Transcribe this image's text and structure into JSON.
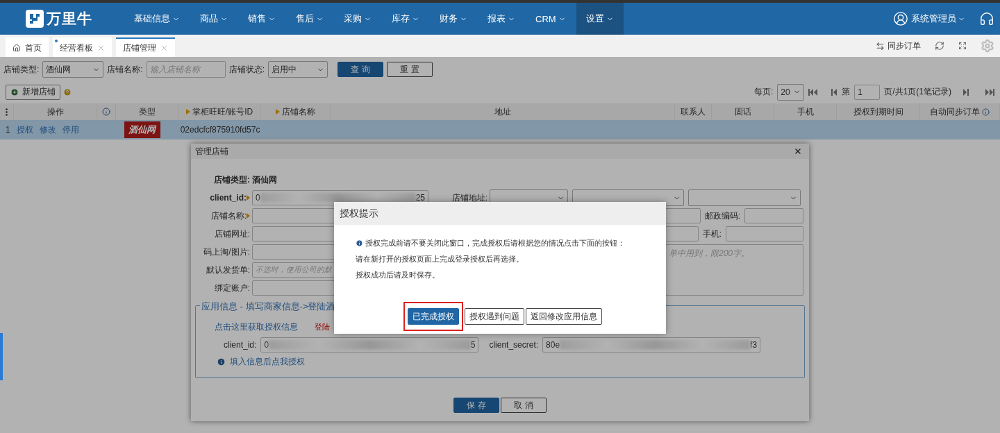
{
  "nav": {
    "logo_text": "万里牛",
    "menus": [
      {
        "label": "基础信息",
        "selected": false
      },
      {
        "label": "商品",
        "selected": false
      },
      {
        "label": "销售",
        "selected": false
      },
      {
        "label": "售后",
        "selected": false
      },
      {
        "label": "采购",
        "selected": false
      },
      {
        "label": "库存",
        "selected": false
      },
      {
        "label": "财务",
        "selected": false
      },
      {
        "label": "报表",
        "selected": false
      },
      {
        "label": "CRM",
        "selected": false
      },
      {
        "label": "设置",
        "selected": true
      }
    ],
    "user": "系统管理员"
  },
  "tabs": [
    {
      "label": "首页",
      "kind": "home",
      "selected": false,
      "unread": false
    },
    {
      "label": "经营看板",
      "kind": "closable",
      "selected": false,
      "unread": true
    },
    {
      "label": "店铺管理",
      "kind": "closable",
      "selected": true,
      "unread": false
    }
  ],
  "toolbar": {
    "sync_label": "同步订单"
  },
  "filters": {
    "type_label": "店铺类型:",
    "type_value": "酒仙网",
    "name_label": "店铺名称:",
    "name_placeholder": "输入店铺名称",
    "status_label": "店铺状态:",
    "status_value": "启用中",
    "search_button": "查 询",
    "reset_button": "重 置"
  },
  "actions": {
    "add_button": "新增店铺"
  },
  "pagination": {
    "per_page_label": "每页:",
    "per_page": "20",
    "page_prefix": "第",
    "page": "1",
    "page_suffix": "页/共1页(1笔记录)"
  },
  "table": {
    "columns": [
      {
        "kind": "menu"
      },
      {
        "kind": "text",
        "label": "操作"
      },
      {
        "kind": "info"
      },
      {
        "kind": "text",
        "label": "类型"
      },
      {
        "kind": "sort",
        "label": "掌柜旺旺/账号ID"
      },
      {
        "kind": "sort",
        "label": "店铺名称"
      },
      {
        "kind": "text",
        "label": "地址"
      },
      {
        "kind": "text",
        "label": "联系人"
      },
      {
        "kind": "text",
        "label": "固话"
      },
      {
        "kind": "text",
        "label": "手机"
      },
      {
        "kind": "text",
        "label": "授权到期时间"
      },
      {
        "kind": "text_info",
        "label": "自动同步订单"
      }
    ],
    "rows": [
      {
        "index": "1",
        "actions": [
          "授权",
          "修改",
          "停用"
        ],
        "logo_text": "酒仙网",
        "account_id": "02edcfcf875910fd57c",
        "selected": true
      }
    ]
  },
  "manage_dialog": {
    "title": "管理店铺",
    "left_fields": [
      {
        "kind": "static",
        "label": "店铺类型:",
        "value": "酒仙网",
        "strong": true,
        "required": false
      },
      {
        "kind": "masked",
        "label": "client_id:",
        "value_start": "0",
        "value_end": "25",
        "strong": true,
        "required": true
      },
      {
        "kind": "input",
        "label": "店铺名称:",
        "strong": false,
        "required": true
      },
      {
        "kind": "input",
        "label": "店铺网址:",
        "strong": false,
        "required": false
      },
      {
        "kind": "input",
        "label": "码上淘/图片:",
        "strong": false,
        "required": false
      },
      {
        "kind": "input",
        "label": "默认发货单:",
        "placeholder": "不选时，使用公司的默",
        "strong": false,
        "required": false
      },
      {
        "kind": "input",
        "label": "绑定账户:",
        "strong": false,
        "required": false
      }
    ],
    "address_label": "店铺地址:",
    "postcode_label": "邮政编码:",
    "mobile_label": "手机:",
    "remark_placeholder": "单中用到，限200字。",
    "app_info": {
      "legend": "应用信息 - 填写商家信息->登陆酒",
      "link": "点击这里获取授权信息",
      "login_text": "登陆",
      "client_id": {
        "label": "client_id:",
        "value_start": "0",
        "value_end": "5"
      },
      "client_secret": {
        "label": "client_secret:",
        "value_start": "80e",
        "value_end": "f3"
      },
      "hint": "填入信息后点我授权"
    },
    "save_button": "保 存",
    "cancel_button": "取 消"
  },
  "prompt": {
    "title": "授权提示",
    "lines": [
      "授权完成前请不要关闭此窗口，完成授权后请根据您的情况点击下面的按钮：",
      "请在新打开的授权页面上完成登录授权后再选择。",
      "授权成功后请及时保存。"
    ],
    "buttons": [
      {
        "label": "已完成授权",
        "kind": "primary",
        "highlighted": true
      },
      {
        "label": "授权遇到问题",
        "kind": "default",
        "highlighted": false
      },
      {
        "label": "返回修改应用信息",
        "kind": "default",
        "highlighted": false
      }
    ]
  }
}
